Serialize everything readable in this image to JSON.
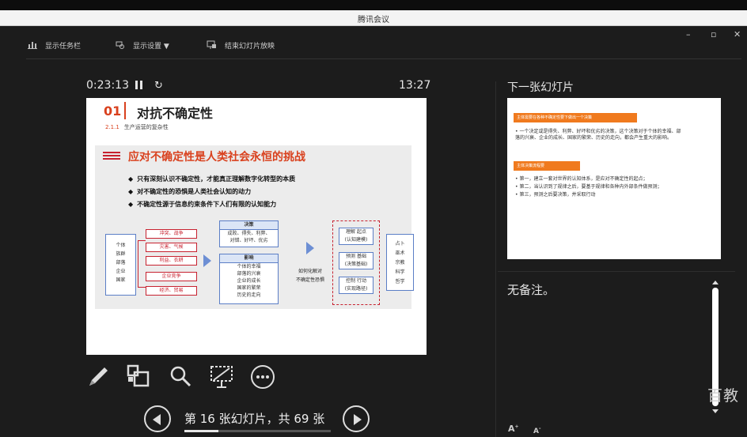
{
  "window": {
    "title": "腾讯会议"
  },
  "toolbar": {
    "taskbar_label": "显示任务栏",
    "display_settings_label": "显示设置 ▼",
    "end_slideshow_label": "结束幻灯片放映",
    "minimize": "–",
    "restore": "▫",
    "close": "✕"
  },
  "presenter": {
    "elapsed": "0:23:13",
    "clock": "13:27"
  },
  "current_slide": {
    "number": "01",
    "title": "对抗不确定性",
    "section_no": "2.1.1",
    "section_title": "生产运营的复杂性",
    "heading": "应对不确定性是人类社会永恒的挑战",
    "bullets": [
      "只有深刻认识不确定性，才能真正理解数字化转型的本质",
      "对不确定性的恐惧是人类社会认知的动力",
      "不确定性源于信息约束条件下人们有限的认知能力"
    ],
    "left_column": [
      "个体",
      "族群",
      "部落",
      "企业",
      "国家"
    ],
    "red_items": [
      "冲突、战争",
      "灾害、气候",
      "利益、衣耕",
      "企业竞争",
      "经济、贸易"
    ],
    "decision_box": {
      "title": "决策",
      "lines": [
        "成败、得失、利弊、",
        "对错、好坏、优劣"
      ]
    },
    "impact_box": {
      "title": "影响",
      "lines": [
        "个体的幸福",
        "部落的兴衰",
        "企业的成长",
        "国家的繁荣",
        "历史的走向"
      ]
    },
    "mid_note": [
      "如何化解对",
      "不确定性恐惧"
    ],
    "dash_items": [
      [
        "理解 起点",
        "(认知建模)"
      ],
      [
        "预测 基础",
        "(决策基础)"
      ],
      [
        "控制 行动",
        "(实现路径)"
      ]
    ],
    "right_column": [
      "占卜",
      "巫术",
      "宗教",
      "科学",
      "哲学"
    ]
  },
  "navigation": {
    "status": "第 16 张幻灯片，共 69 张",
    "progress": 0.23
  },
  "next_slide": {
    "label": "下一张幻灯片",
    "tag1": "主体需要在各种不确定性要下做出一个决策",
    "text1": "• 一个决定或是得失、利弊、好坏和优劣的决策，这个决策对于个体的幸福、部落的兴衰、企业的成长、国家的繁荣、历史的走向，都会产生重大的影响。",
    "tag2": "主体决策流程要",
    "text2": [
      "• 第一，建立一套对世界的认知体系，是应对不确定性的起点；",
      "• 第二，当认识到了规律之后，要基于规律和各种内外部条件做预测；",
      "• 第三，预测之后要决策，并采取行动"
    ]
  },
  "notes": {
    "text": "无备注。"
  },
  "font_controls": {
    "increase": "A",
    "decrease": "A"
  },
  "watermark": "百教"
}
